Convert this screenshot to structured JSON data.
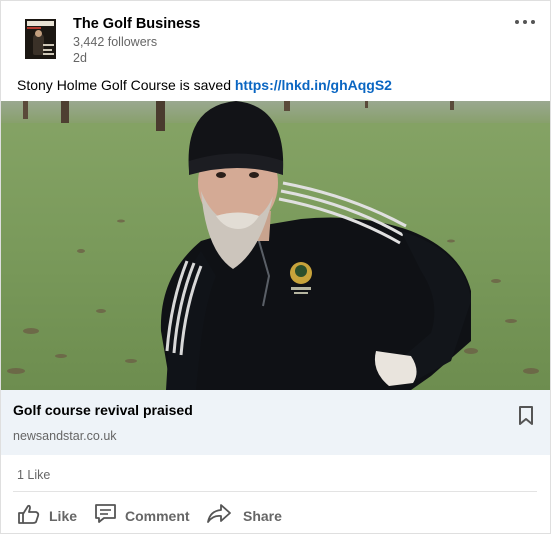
{
  "post": {
    "author": {
      "name": "The Golf Business",
      "followers": "3,442 followers",
      "time": "2d",
      "logo_icon": "golf-business-magazine-cover-logo"
    },
    "more_icon": "three-dots-icon",
    "text": {
      "body": "Stony Holme Golf Course is saved ",
      "link": "https://lnkd.in/ghAqgS2"
    },
    "image": {
      "subject": "man-in-beanie-crouching-on-golf-course"
    },
    "link_preview": {
      "title": "Golf course revival praised",
      "source": "newsandstar.co.uk",
      "bookmark_icon": "bookmark-icon"
    },
    "social_counts": {
      "likes": "1 Like"
    },
    "actions": {
      "like": "Like",
      "comment": "Comment",
      "share": "Share"
    }
  },
  "colors": {
    "link": "#0a66c2",
    "secondary_text": "#666666",
    "preview_bg": "#eef3f8"
  }
}
